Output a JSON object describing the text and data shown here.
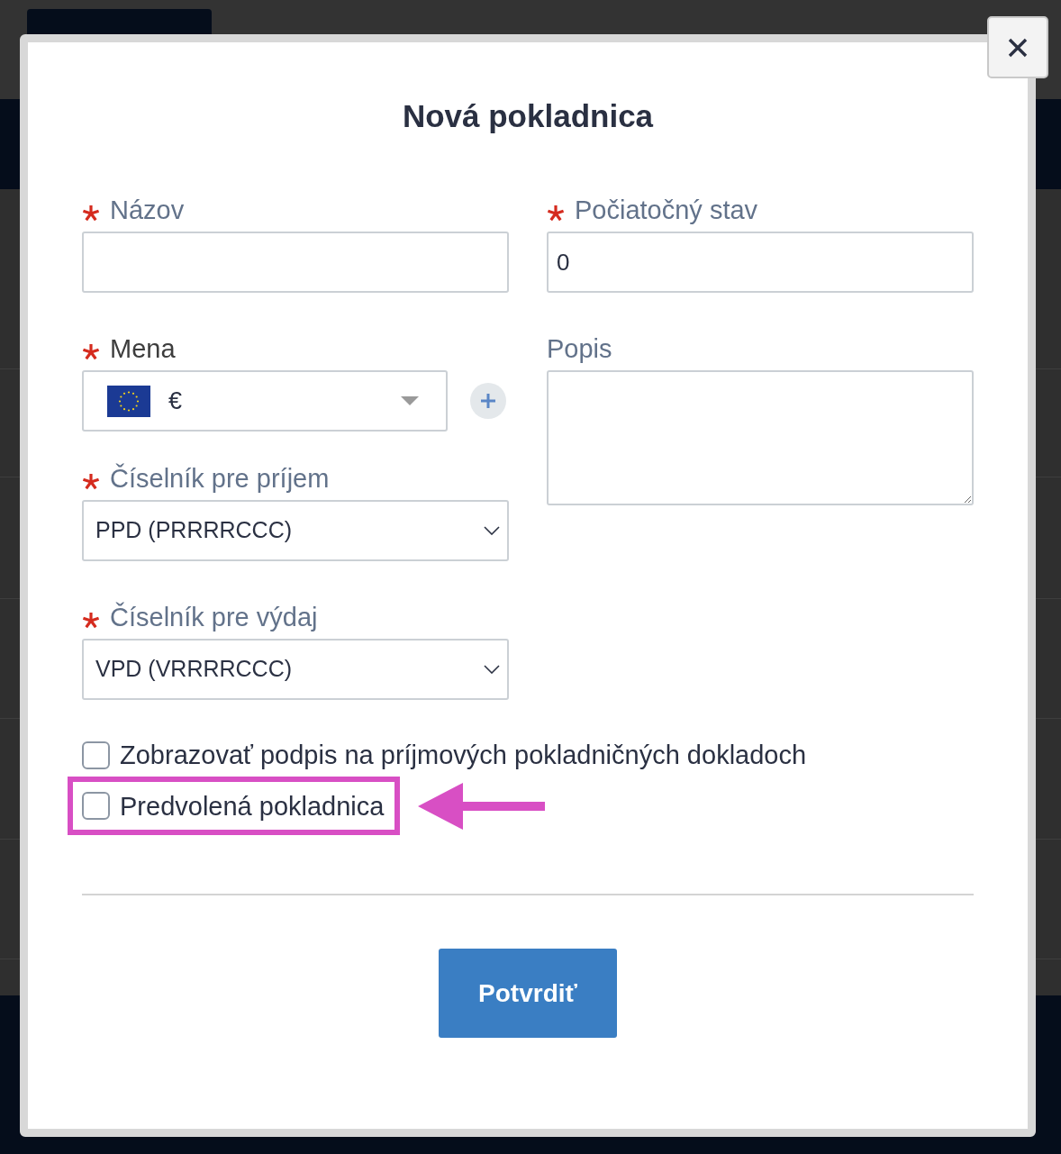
{
  "dialog": {
    "title": "Nová pokladnica",
    "columns": [
      {
        "fields": [
          {
            "kind": "text",
            "label": "Názov",
            "required": true
          },
          {
            "kind": "currency",
            "label": "Mena",
            "required": true,
            "value": "€"
          },
          {
            "kind": "select",
            "label": "Číselník pre príjem",
            "required": true,
            "value": "PPD (PRRRRCCC)"
          },
          {
            "kind": "select",
            "label": "Číselník pre výdaj",
            "required": true,
            "value": "VPD (VRRRRCCC)"
          }
        ]
      },
      {
        "fields": [
          {
            "kind": "text",
            "label": "Počiatočný stav",
            "required": true,
            "value": "0"
          },
          {
            "kind": "textarea",
            "label": "Popis",
            "required": false
          }
        ]
      }
    ],
    "checkboxes": [
      {
        "label": "Zobrazovať podpis na príjmových pokladničných dokladoch",
        "checked": false,
        "highlighted": false
      },
      {
        "label": "Predvolená pokladnica",
        "checked": false,
        "highlighted": true
      }
    ],
    "submit": {
      "label": "Potvrdiť"
    }
  }
}
